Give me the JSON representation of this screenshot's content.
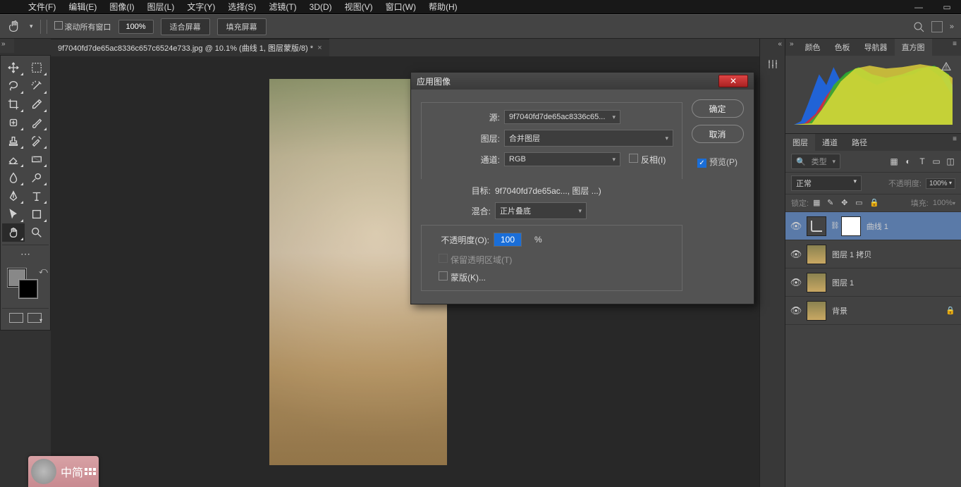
{
  "menu": [
    "文件(F)",
    "编辑(E)",
    "图像(I)",
    "图层(L)",
    "文字(Y)",
    "选择(S)",
    "滤镜(T)",
    "3D(D)",
    "视图(V)",
    "窗口(W)",
    "帮助(H)"
  ],
  "options": {
    "scroll_all": "滚动所有窗口",
    "zoom": "100%",
    "fit": "适合屏幕",
    "fill": "填充屏幕"
  },
  "doc_tab": {
    "title": "9f7040fd7de65ac8336c657c6524e733.jpg @ 10.1% (曲线 1, 图层蒙版/8) *"
  },
  "right_tabs1": [
    "颜色",
    "色板",
    "导航器",
    "直方图"
  ],
  "right_tabs2": [
    "图层",
    "通道",
    "路径"
  ],
  "layer_ctrl": {
    "type_search_placeholder": "类型",
    "blend": "正常",
    "opacity_label": "不透明度:",
    "opacity": "100%",
    "lock_label": "锁定:",
    "fill_label": "填充:",
    "fill": "100%"
  },
  "layers": [
    {
      "name": "曲线 1",
      "kind": "adj",
      "sel": true
    },
    {
      "name": "图层 1 拷贝",
      "kind": "ph"
    },
    {
      "name": "图层 1",
      "kind": "ph"
    },
    {
      "name": "背景",
      "kind": "ph",
      "locked": true
    }
  ],
  "dialog": {
    "title": "应用图像",
    "source_label": "源:",
    "source": "9f7040fd7de65ac8336c65...",
    "layer_label": "图层:",
    "layer": "合并图层",
    "channel_label": "通道:",
    "channel": "RGB",
    "invert": "反相(I)",
    "target_label": "目标:",
    "target": "9f7040fd7de65ac..., 图层 ...)",
    "blend_label": "混合:",
    "blend": "正片叠底",
    "opacity_label": "不透明度(O):",
    "opacity": "100",
    "pct": "%",
    "preserve": "保留透明区域(T)",
    "mask": "蒙版(K)...",
    "ok": "确定",
    "cancel": "取消",
    "preview": "预览(P)"
  },
  "ime": {
    "text": "中简"
  }
}
